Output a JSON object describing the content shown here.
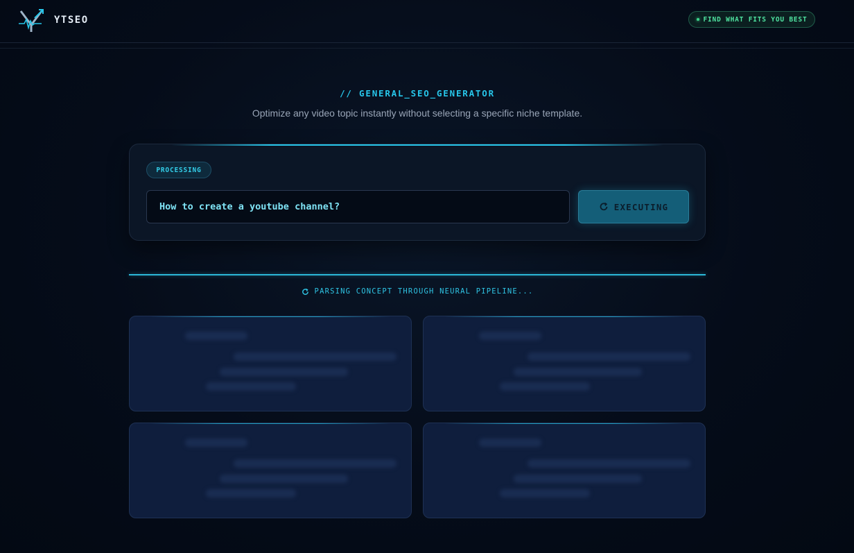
{
  "header": {
    "brand": "YTSEO",
    "cta_label": "FIND WHAT FITS YOU BEST"
  },
  "section": {
    "title": "// GENERAL_SEO_GENERATOR",
    "subtitle": "Optimize any video topic instantly without selecting a specific niche template."
  },
  "input_card": {
    "status": "PROCESSING",
    "topic_value": "How to create a youtube channel?",
    "button_label": "EXECUTING"
  },
  "loading": {
    "text": "PARSING CONCEPT THROUGH NEURAL PIPELINE..."
  },
  "colors": {
    "accent_cyan": "#27c6ea",
    "accent_green": "#4fe3a0",
    "background": "#040b17",
    "skeleton_card": "#0f1e3d"
  },
  "icons": {
    "logo": "ytseo-logo-icon",
    "cta": "status-dot-icon",
    "button": "refresh-icon",
    "loading": "spinner-icon"
  }
}
